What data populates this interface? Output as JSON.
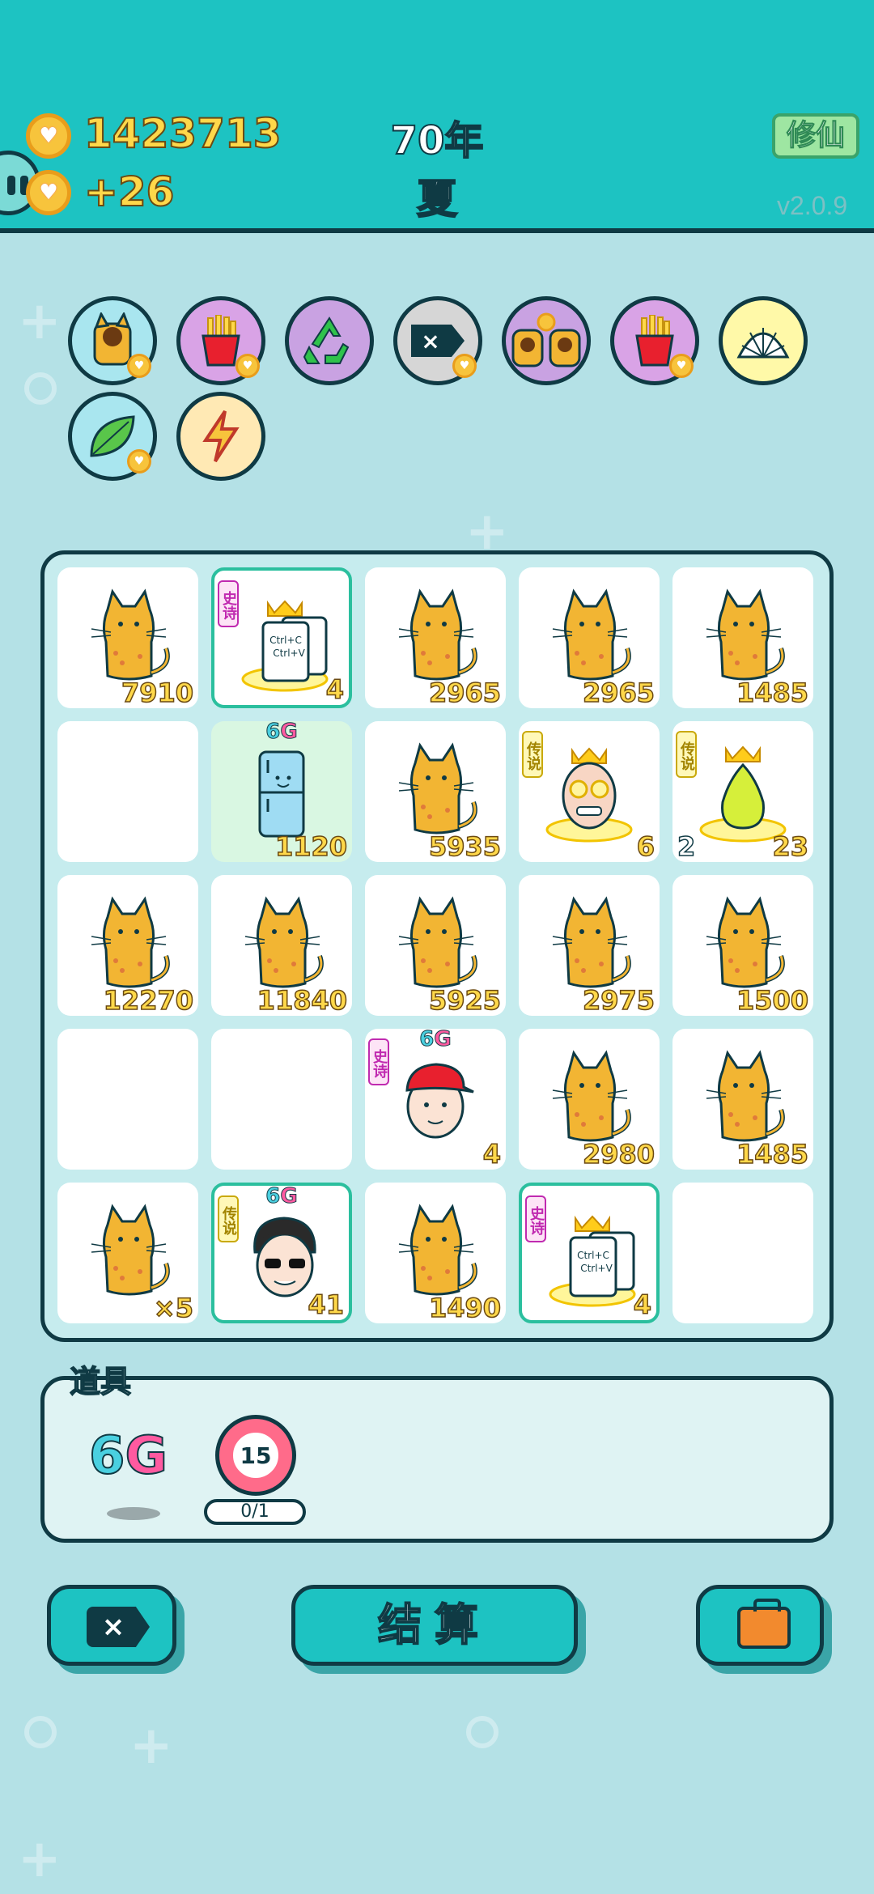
{
  "header": {
    "coins": "1423713",
    "income": "+26",
    "year": "70年",
    "season": "夏",
    "mode_button": "修仙",
    "version": "v2.0.9"
  },
  "relics": [
    {
      "icon": "cat-head-icon",
      "bg": "#a9e6ef"
    },
    {
      "icon": "fries-icon",
      "bg": "#d9a3e6"
    },
    {
      "icon": "recycle-icon",
      "bg": "#c9a2e2"
    },
    {
      "icon": "remove-tag-icon",
      "bg": "#d6d6d6"
    },
    {
      "icon": "twin-cats-icon",
      "bg": "#c9a2e2"
    },
    {
      "icon": "fries-icon",
      "bg": "#d9a3e6"
    },
    {
      "icon": "shell-icon",
      "bg": "#fff9a8"
    },
    {
      "icon": "leaf-icon",
      "bg": "#a9e6ef"
    },
    {
      "icon": "lightning-icon",
      "bg": "#ffe9b4"
    }
  ],
  "board": {
    "cells": [
      {
        "item": "cat",
        "count": "7910"
      },
      {
        "item": "copy-paste",
        "tag": "史诗",
        "tag_type": "epic",
        "count": "4",
        "highlight": true
      },
      {
        "item": "cat",
        "count": "2965"
      },
      {
        "item": "cat",
        "count": "2965"
      },
      {
        "item": "cat",
        "count": "1485"
      },
      {
        "item": "empty"
      },
      {
        "item": "fridge",
        "badge": "6G",
        "count": "1120",
        "green": true
      },
      {
        "item": "cat",
        "count": "5935"
      },
      {
        "item": "grandpa",
        "tag": "传说",
        "tag_type": "legend",
        "count": "6"
      },
      {
        "item": "pear",
        "tag": "传说",
        "tag_type": "legend",
        "count": "23",
        "left_count": "2"
      },
      {
        "item": "cat",
        "count": "12270"
      },
      {
        "item": "cat",
        "count": "11840"
      },
      {
        "item": "cat",
        "count": "5925"
      },
      {
        "item": "cat",
        "count": "2975"
      },
      {
        "item": "cat",
        "count": "1500"
      },
      {
        "item": "empty"
      },
      {
        "item": "empty"
      },
      {
        "item": "boy-red-hat",
        "tag": "史诗",
        "tag_type": "epic",
        "badge": "6G",
        "count": "4"
      },
      {
        "item": "cat",
        "count": "2980"
      },
      {
        "item": "cat",
        "count": "1485"
      },
      {
        "item": "cat",
        "count": "×5"
      },
      {
        "item": "sunglasses-man",
        "tag": "传说",
        "tag_type": "legend",
        "badge": "6G",
        "count": "41",
        "highlight": true
      },
      {
        "item": "cat",
        "count": "1490"
      },
      {
        "item": "copy-paste",
        "tag": "史诗",
        "tag_type": "epic",
        "count": "4",
        "highlight": true
      },
      {
        "item": "empty"
      }
    ]
  },
  "items": {
    "title": "道具",
    "sixg_a": "6",
    "sixg_b": "G",
    "target_value": "15",
    "target_label": "0/1"
  },
  "buttons": {
    "remove_icon": "×",
    "settle": "结算",
    "bag_icon": "briefcase-icon"
  },
  "copy_paste": {
    "line1": "Ctrl+C",
    "line2": "Ctrl+V"
  }
}
